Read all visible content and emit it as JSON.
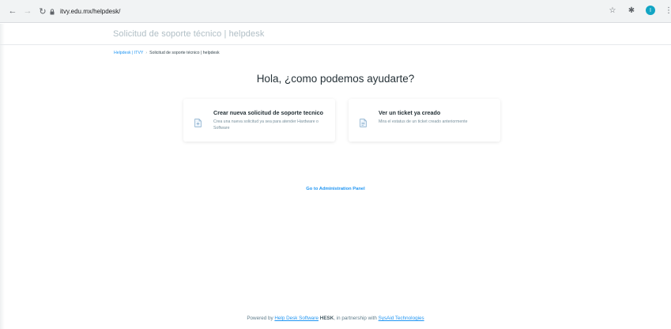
{
  "browser": {
    "url": "itvy.edu.mx/helpdesk/",
    "avatar_letter": "I"
  },
  "header": {
    "title": "Solicitud de soporte técnico | helpdesk"
  },
  "breadcrumb": {
    "home": "Helpdesk | ITVY",
    "separator": "›",
    "current": "Solicitud de soporte técnico | helpdesk"
  },
  "main": {
    "heading": "Hola, ¿como podemos ayudarte?",
    "cards": [
      {
        "title": "Crear nueva solicitud de soporte tecnico",
        "description": "Crea una nueva solicitud ya sea para atender Hardware o Software",
        "icon": "document-add-icon"
      },
      {
        "title": "Ver un ticket ya creado",
        "description": "Mira el estatus de un ticket creado anteriormente",
        "icon": "document-view-icon"
      }
    ],
    "admin_link": "Go to Administration Panel"
  },
  "footer": {
    "prefix": "Powered by",
    "link1": "Help Desk Software",
    "brand": "HESK",
    "middle": ", in partnership with",
    "link2": "SysAid Technologies"
  },
  "colors": {
    "accent": "#2196f3",
    "title_muted": "#b0bec5",
    "text": "#263238"
  }
}
